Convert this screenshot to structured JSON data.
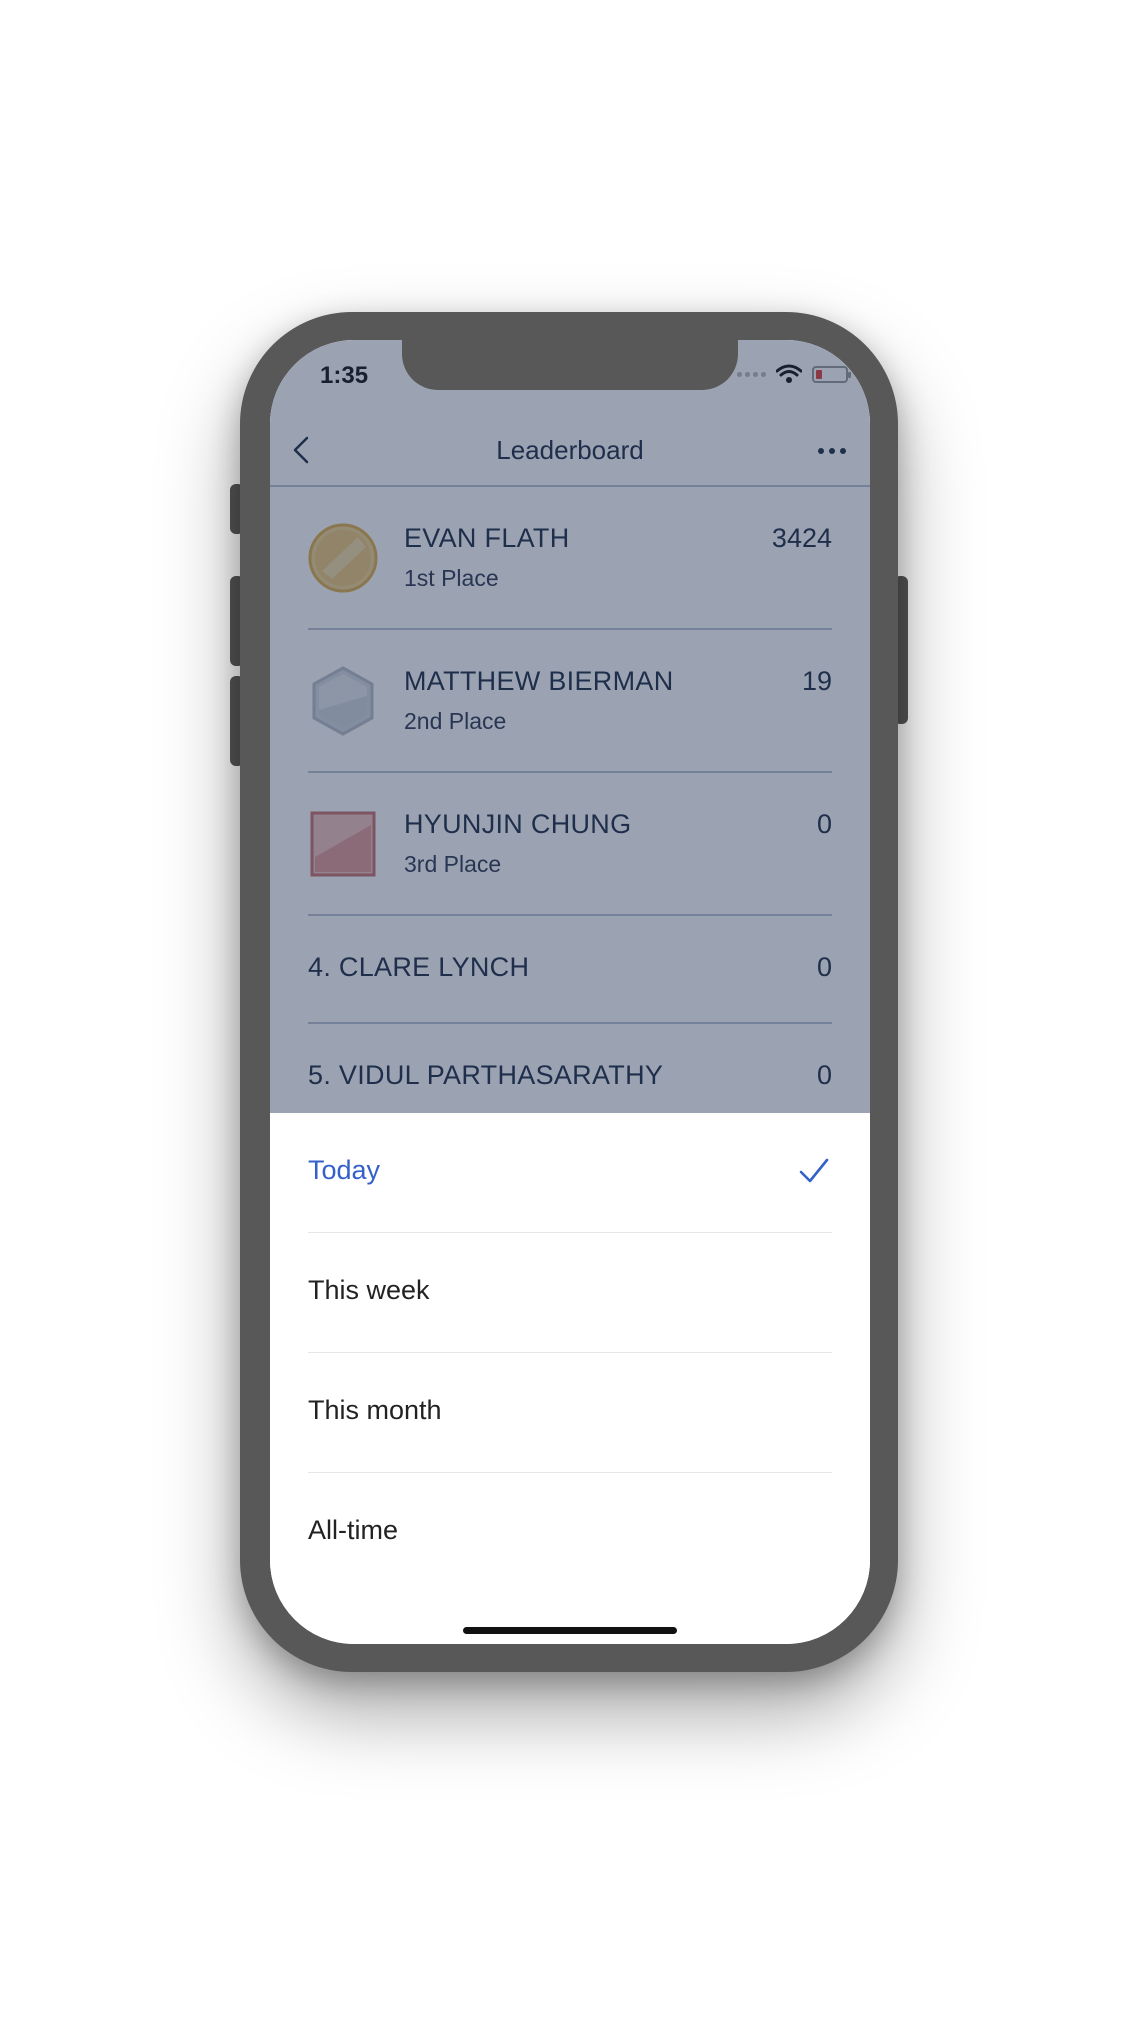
{
  "status_bar": {
    "time": "1:35",
    "icons": [
      "signal-dots-icon",
      "wifi-icon",
      "battery-low-icon"
    ],
    "battery_color": "#e23d3d"
  },
  "navbar": {
    "back_icon": "chevron-left-icon",
    "title": "Leaderboard",
    "more_icon": "more-horizontal-icon"
  },
  "leaderboard": {
    "podium": [
      {
        "name": "EVAN FLATH",
        "place": "1st Place",
        "score": "3424",
        "badge": "gold-circle-badge",
        "color": "#e0b04c"
      },
      {
        "name": "MATTHEW BIERMAN",
        "place": "2nd Place",
        "score": "19",
        "badge": "silver-hexagon-badge",
        "color": "#b8bec7"
      },
      {
        "name": "HYUNJIN CHUNG",
        "place": "3rd Place",
        "score": "0",
        "badge": "bronze-square-badge",
        "color": "#c9706d"
      }
    ],
    "others": [
      {
        "name": "4. CLARE LYNCH",
        "score": "0"
      },
      {
        "name": "5. VIDUL PARTHASARATHY",
        "score": "0"
      }
    ]
  },
  "time_filter_sheet": {
    "options": [
      {
        "label": "Today",
        "selected": true
      },
      {
        "label": "This week",
        "selected": false
      },
      {
        "label": "This month",
        "selected": false
      },
      {
        "label": "All-time",
        "selected": false
      }
    ],
    "accent_color": "#3460c9",
    "check_icon": "checkmark-icon"
  }
}
